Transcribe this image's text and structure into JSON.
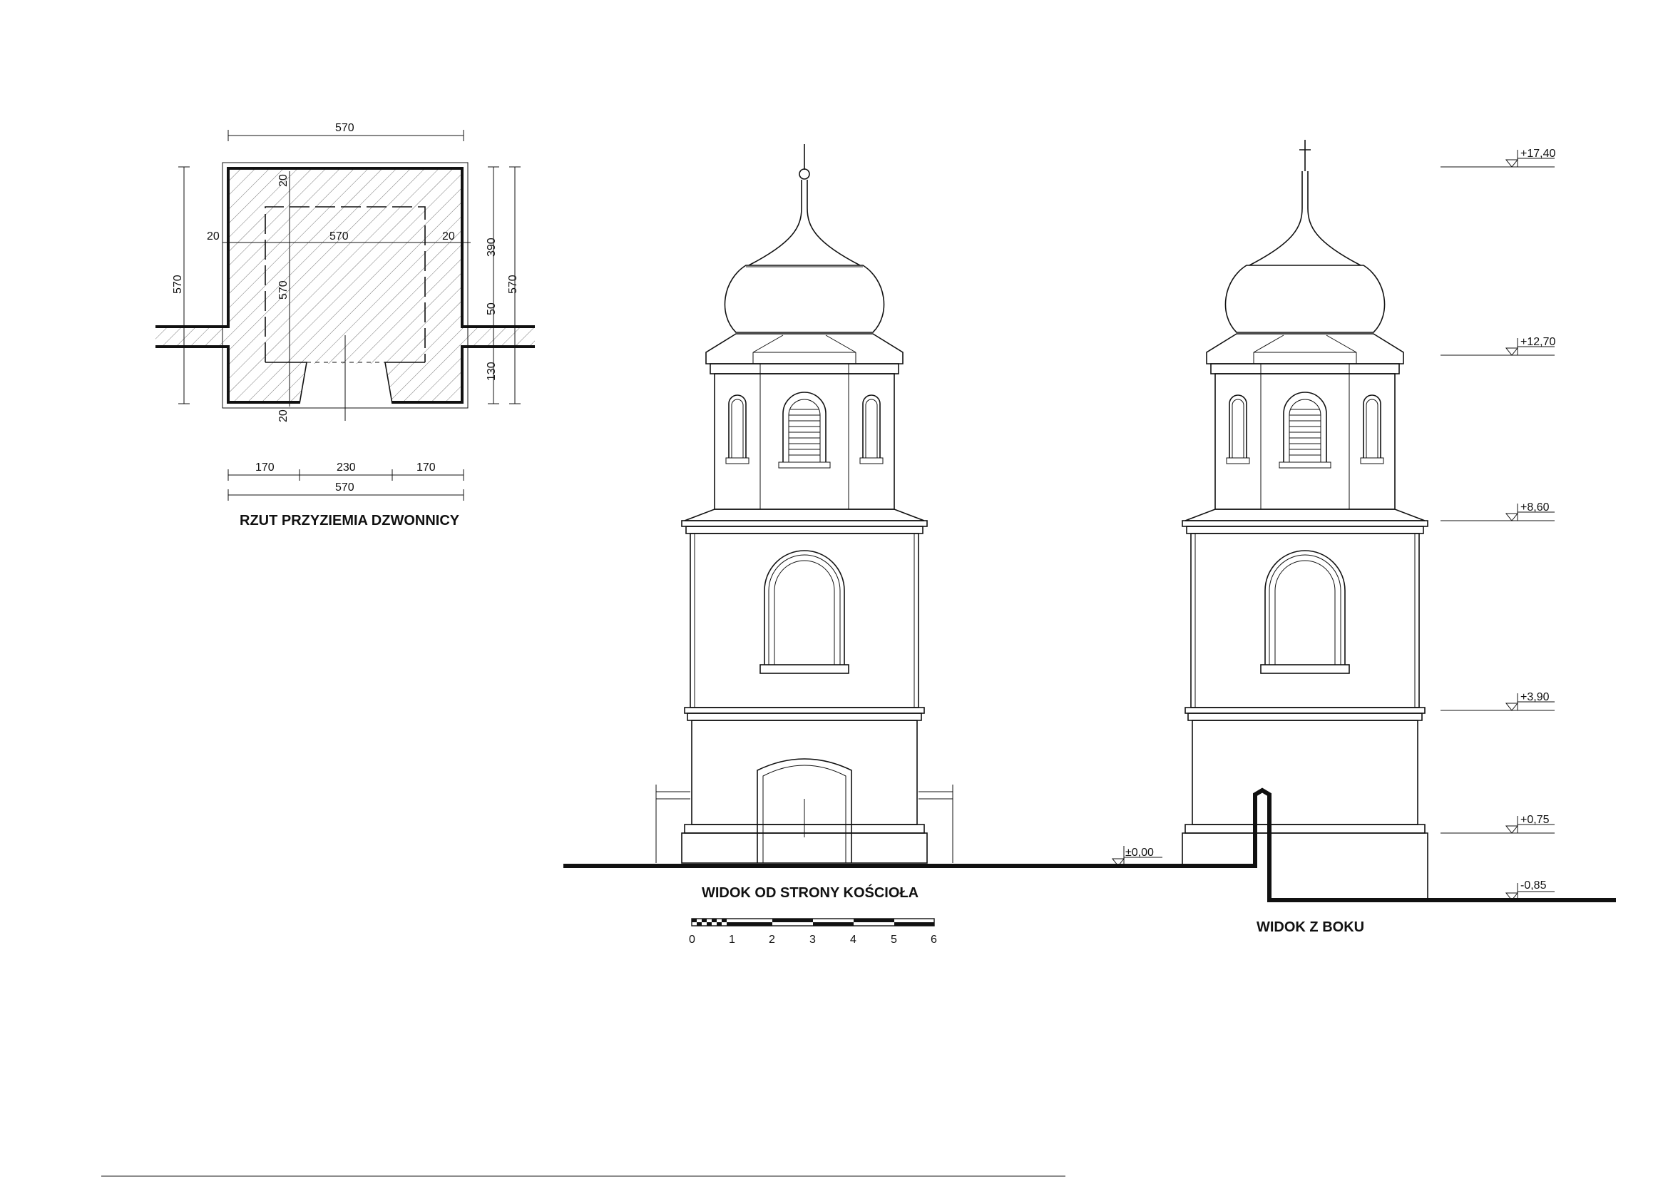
{
  "plan": {
    "title": "RZUT PRZYZIEMIA DZWONNICY",
    "dim_top": "570",
    "dim_inner_width": "570",
    "dim_wall_left": "20",
    "dim_wall_right": "20",
    "dim_wall_top": "20",
    "dim_wall_bottom": "20",
    "dim_inner_height": "570",
    "dim_left": "570",
    "dim_right_1": "390",
    "dim_right_2": "50",
    "dim_right_3": "130",
    "dim_right_total": "570",
    "dim_bottom_1": "170",
    "dim_bottom_2": "230",
    "dim_bottom_3": "170",
    "dim_bottom_total": "570"
  },
  "elevation_front": {
    "title": "WIDOK OD STRONY KOŚCIOŁA"
  },
  "elevation_side": {
    "title": "WIDOK Z BOKU"
  },
  "levels": {
    "l1": "+17,40",
    "l2": "+12,70",
    "l3": "+8,60",
    "l4": "+3,90",
    "l5": "+0,75",
    "l6": "-0,85",
    "ground": "±0,00"
  },
  "scale_bar": {
    "labels": [
      "0",
      "1",
      "2",
      "3",
      "4",
      "5",
      "6"
    ]
  }
}
